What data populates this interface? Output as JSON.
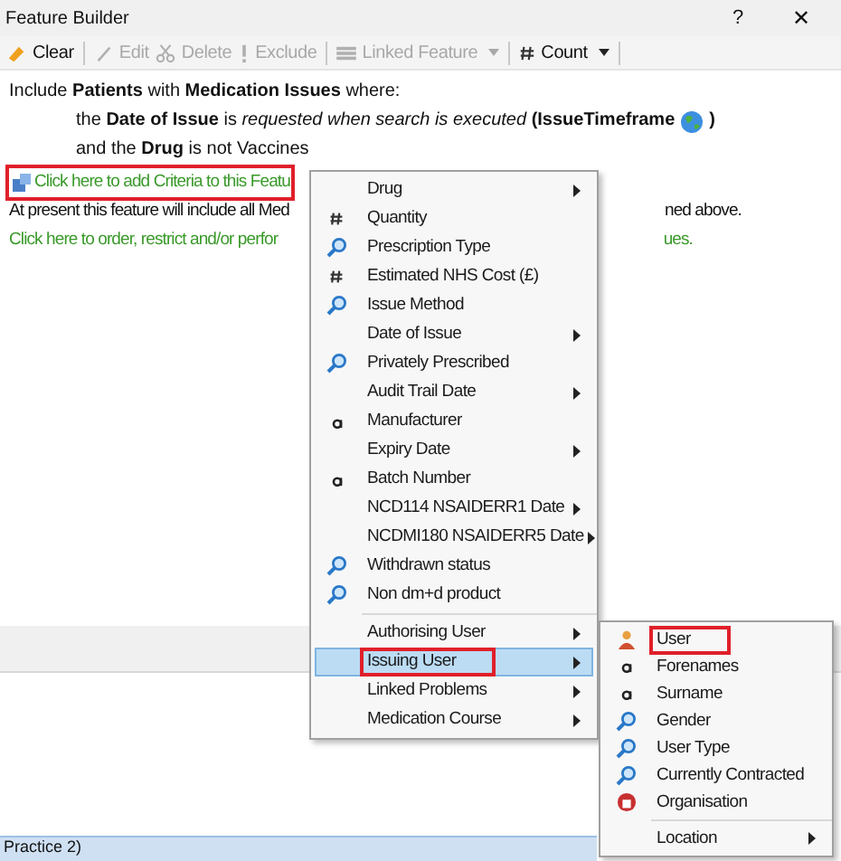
{
  "window": {
    "title": "Feature Builder",
    "help": "?",
    "close": "✕"
  },
  "toolbar": [
    {
      "label": "Clear",
      "kind": "eraser",
      "disabled": false,
      "dropdown": false
    },
    {
      "label": "Edit",
      "kind": "pencil",
      "disabled": true,
      "dropdown": false
    },
    {
      "label": "Delete",
      "kind": "scissors",
      "disabled": true,
      "dropdown": false
    },
    {
      "label": "Exclude",
      "kind": "exclamation",
      "disabled": true,
      "dropdown": false
    },
    {
      "label": "Linked Feature",
      "kind": "list",
      "disabled": true,
      "dropdown": true
    },
    {
      "label": "Count",
      "kind": "hash",
      "disabled": false,
      "dropdown": true
    }
  ],
  "description": {
    "line_1": "Include **Patients** with **Medication Issues** where:",
    "line_2_start": "the **Date of Issue** is ",
    "line_2_italic": "requested when search is executed",
    "line_2_end": " **(IssueTimeframe**",
    "line_2_close": "**)**",
    "line_3": "and the **Drug** is not Vaccines"
  },
  "add_criteria_link": {
    "label": "Click here to add Criteria to this Featu",
    "highlighted": true
  },
  "info_line": {
    "left": "At present this feature will include all Med",
    "right": "ned above."
  },
  "order_link": {
    "left": "Click here to order, restrict and/or perfor",
    "right": "ues."
  },
  "status_bar": "Practice 2)",
  "menu": {
    "groups": [
      [
        {
          "label": "Drug",
          "kind": "plain",
          "submenu": true,
          "selected": false,
          "highlighted": false
        },
        {
          "label": "Quantity",
          "kind": "number",
          "submenu": false,
          "selected": false,
          "highlighted": false
        },
        {
          "label": "Prescription Type",
          "kind": "search",
          "submenu": false,
          "selected": false,
          "highlighted": false
        },
        {
          "label": "Estimated NHS Cost (£)",
          "kind": "number",
          "submenu": false,
          "selected": false,
          "highlighted": false
        },
        {
          "label": "Issue Method",
          "kind": "search",
          "submenu": false,
          "selected": false,
          "highlighted": false
        },
        {
          "label": "Date of Issue",
          "kind": "plain",
          "submenu": true,
          "selected": false,
          "highlighted": false
        },
        {
          "label": "Privately Prescribed",
          "kind": "search",
          "submenu": false,
          "selected": false,
          "highlighted": false
        },
        {
          "label": "Audit Trail Date",
          "kind": "plain",
          "submenu": true,
          "selected": false,
          "highlighted": false
        },
        {
          "label": "Manufacturer",
          "kind": "text",
          "submenu": false,
          "selected": false,
          "highlighted": false
        },
        {
          "label": "Expiry Date",
          "kind": "plain",
          "submenu": true,
          "selected": false,
          "highlighted": false
        },
        {
          "label": "Batch Number",
          "kind": "text",
          "submenu": false,
          "selected": false,
          "highlighted": false
        },
        {
          "label": "NCD114 NSAIDERR1 Date",
          "kind": "plain",
          "submenu": true,
          "selected": false,
          "highlighted": false
        },
        {
          "label": "NCDMI180 NSAIDERR5 Date",
          "kind": "plain",
          "submenu": true,
          "selected": false,
          "highlighted": false
        },
        {
          "label": "Withdrawn status",
          "kind": "search",
          "submenu": false,
          "selected": false,
          "highlighted": false
        },
        {
          "label": "Non dm+d product",
          "kind": "search",
          "submenu": false,
          "selected": false,
          "highlighted": false
        }
      ],
      [
        {
          "label": "Authorising User",
          "kind": "plain",
          "submenu": true,
          "selected": false,
          "highlighted": false
        },
        {
          "label": "Issuing User",
          "kind": "plain",
          "submenu": true,
          "selected": true,
          "highlighted": true
        },
        {
          "label": "Linked Problems",
          "kind": "plain",
          "submenu": true,
          "selected": false,
          "highlighted": false
        },
        {
          "label": "Medication Course",
          "kind": "plain",
          "submenu": true,
          "selected": false,
          "highlighted": false
        }
      ]
    ]
  },
  "submenu": {
    "groups": [
      [
        {
          "label": "User",
          "kind": "user",
          "submenu": false,
          "selected": false,
          "highlighted": true
        },
        {
          "label": "Forenames",
          "kind": "text",
          "submenu": false,
          "selected": false,
          "highlighted": false
        },
        {
          "label": "Surname",
          "kind": "text",
          "submenu": false,
          "selected": false,
          "highlighted": false
        },
        {
          "label": "Gender",
          "kind": "search",
          "submenu": false,
          "selected": false,
          "highlighted": false
        },
        {
          "label": "User Type",
          "kind": "search",
          "submenu": false,
          "selected": false,
          "highlighted": false
        },
        {
          "label": "Currently Contracted",
          "kind": "search",
          "submenu": false,
          "selected": false,
          "highlighted": false
        },
        {
          "label": "Organisation",
          "kind": "org",
          "submenu": false,
          "selected": false,
          "highlighted": false
        }
      ],
      [
        {
          "label": "Location",
          "kind": "plain",
          "submenu": true,
          "selected": false,
          "highlighted": false
        }
      ]
    ]
  }
}
